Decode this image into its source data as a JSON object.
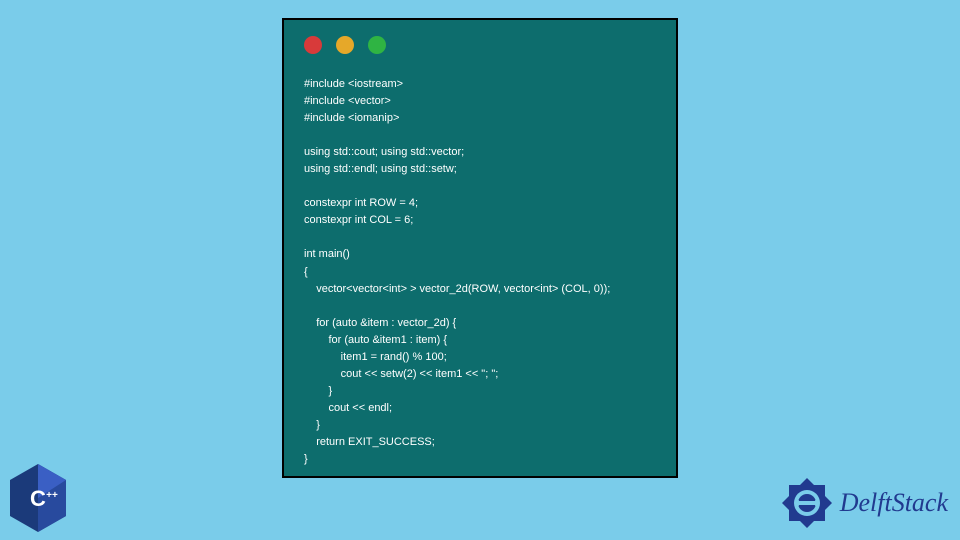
{
  "window": {
    "lights": [
      "red",
      "yellow",
      "green"
    ]
  },
  "code": "#include <iostream>\n#include <vector>\n#include <iomanip>\n\nusing std::cout; using std::vector;\nusing std::endl; using std::setw;\n\nconstexpr int ROW = 4;\nconstexpr int COL = 6;\n\nint main()\n{\n    vector<vector<int> > vector_2d(ROW, vector<int> (COL, 0));\n\n    for (auto &item : vector_2d) {\n        for (auto &item1 : item) {\n            item1 = rand() % 100;\n            cout << setw(2) << item1 << \"; \";\n        }\n        cout << endl;\n    }\n    return EXIT_SUCCESS;\n}",
  "badges": {
    "cpp_label": "C++",
    "brand_name": "DelftStack"
  },
  "colors": {
    "page_bg": "#7accea",
    "window_bg": "#0d6d6d",
    "code_text": "#ffffff",
    "brand_text": "#213a8f"
  }
}
